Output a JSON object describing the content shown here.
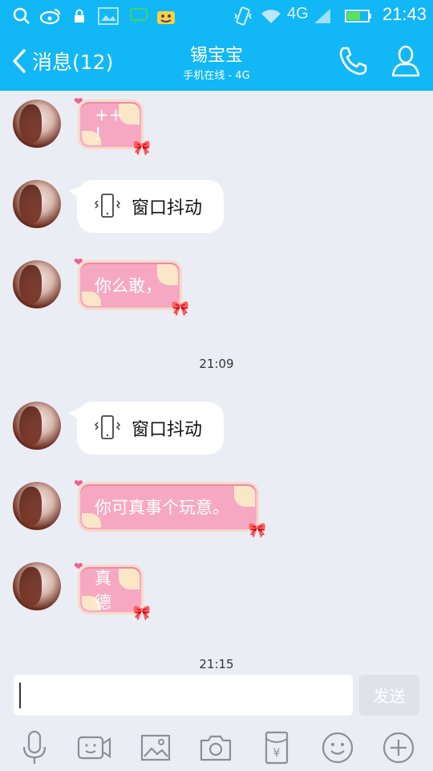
{
  "status_bar": {
    "time": "21:43",
    "network": "4G",
    "icons": [
      "search-icon",
      "weibo-icon",
      "lock-icon",
      "image-icon",
      "chat-icon",
      "android-icon",
      "vibrate-icon",
      "wifi-icon",
      "signal-icon",
      "battery-icon"
    ]
  },
  "header": {
    "back_label": "消息(12)",
    "title": "锡宝宝",
    "subtitle": "手机在线 - 4G",
    "call_icon": "phone-icon",
    "profile_icon": "person-icon"
  },
  "messages": [
    {
      "type": "text",
      "text": "++ !"
    },
    {
      "type": "shake",
      "text": "窗口抖动"
    },
    {
      "type": "text",
      "text": "你么敢，"
    },
    {
      "type": "time",
      "text": "21:09"
    },
    {
      "type": "shake",
      "text": "窗口抖动"
    },
    {
      "type": "text",
      "text": "你可真事个玩意。"
    },
    {
      "type": "text",
      "text": "真德"
    },
    {
      "type": "time",
      "text": "21:15"
    }
  ],
  "input": {
    "placeholder": "",
    "send_label": "发送"
  },
  "toolbar": [
    "microphone-icon",
    "video-icon",
    "image-icon",
    "camera-icon",
    "red-packet-icon",
    "emoji-icon",
    "plus-icon"
  ],
  "colors": {
    "accent": "#12b7f5",
    "bubble_pink": "#f6a8c2",
    "background": "#eaedf4"
  }
}
